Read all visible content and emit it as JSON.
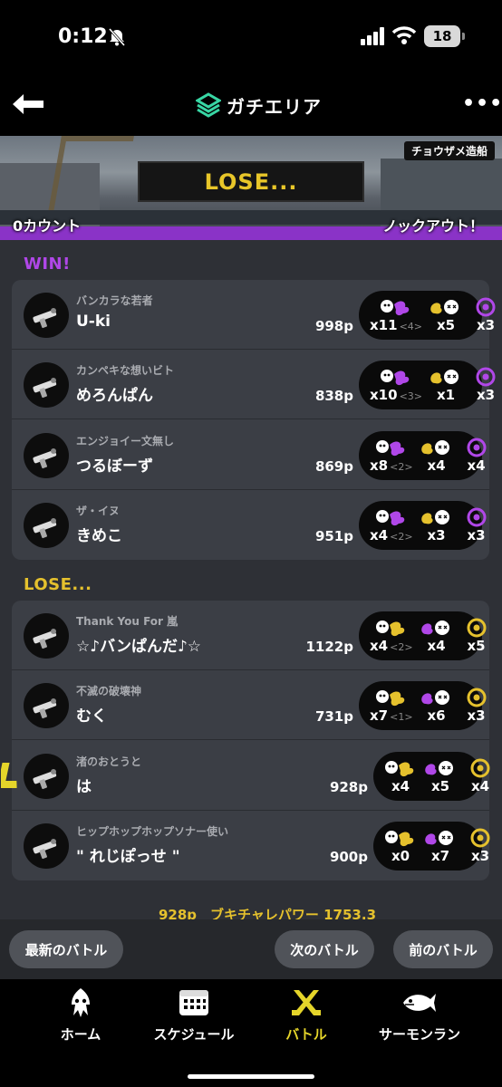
{
  "status": {
    "time": "0:12",
    "battery": "18"
  },
  "header": {
    "title": "ガチエリア"
  },
  "banner": {
    "result": "LOSE...",
    "stage": "チョウザメ造船",
    "our_count": "0カウント",
    "their_count": "ノックアウト！"
  },
  "win_section": {
    "label": "WIN!",
    "players": [
      {
        "title": "バンカラな若者",
        "name": "U-ki",
        "points": "998p",
        "stats": [
          {
            "icon": "kill-icon",
            "value": "x11",
            "sub": "<4>"
          },
          {
            "icon": "death-icon",
            "value": "x5"
          },
          {
            "icon": "special-icon",
            "value": "x3"
          }
        ]
      },
      {
        "title": "カンペキな想いビト",
        "name": "めろんぱん",
        "points": "838p",
        "stats": [
          {
            "icon": "kill-icon",
            "value": "x10",
            "sub": "<3>"
          },
          {
            "icon": "death-icon",
            "value": "x1"
          },
          {
            "icon": "special-icon",
            "value": "x3"
          }
        ]
      },
      {
        "title": "エンジョイー文無し",
        "name": "つるぼーず",
        "points": "869p",
        "stats": [
          {
            "icon": "kill-icon",
            "value": "x8",
            "sub": "<2>"
          },
          {
            "icon": "death-icon",
            "value": "x4"
          },
          {
            "icon": "special-icon",
            "value": "x4"
          }
        ]
      },
      {
        "title": "ザ・イヌ",
        "name": "きめこ",
        "points": "951p",
        "stats": [
          {
            "icon": "kill-icon",
            "value": "x4",
            "sub": "<2>"
          },
          {
            "icon": "death-icon",
            "value": "x3"
          },
          {
            "icon": "special-icon",
            "value": "x3"
          }
        ]
      }
    ]
  },
  "lose_section": {
    "label": "LOSE...",
    "players": [
      {
        "title": "Thank You For 嵐",
        "name": "☆♪バンぱんだ♪☆",
        "points": "1122p",
        "stats": [
          {
            "icon": "kill-icon",
            "value": "x4",
            "sub": "<2>"
          },
          {
            "icon": "death-icon",
            "value": "x4"
          },
          {
            "icon": "special-icon",
            "value": "x5"
          }
        ]
      },
      {
        "title": "不滅の破壊神",
        "name": "むく",
        "points": "731p",
        "stats": [
          {
            "icon": "kill-icon",
            "value": "x7",
            "sub": "<1>"
          },
          {
            "icon": "death-icon",
            "value": "x6"
          },
          {
            "icon": "special-icon",
            "value": "x3"
          }
        ]
      },
      {
        "title": "渚のおとうと",
        "name": "は",
        "points": "928p",
        "stats": [
          {
            "icon": "kill-icon",
            "value": "x4"
          },
          {
            "icon": "death-icon",
            "value": "x5"
          },
          {
            "icon": "special-icon",
            "value": "x4"
          }
        ]
      },
      {
        "title": "ヒップホップホップソナー使い",
        "name": "\" れじぽっせ \"",
        "points": "900p",
        "stats": [
          {
            "icon": "kill-icon",
            "value": "x0"
          },
          {
            "icon": "death-icon",
            "value": "x7"
          },
          {
            "icon": "special-icon",
            "value": "x3"
          }
        ]
      }
    ]
  },
  "power_line": "928p　ブキチャレパワー 1753.3",
  "nav": {
    "latest": "最新のバトル",
    "next": "次のバトル",
    "prev": "前のバトル"
  },
  "tabs": [
    {
      "label": "ホーム",
      "icon": "squid-home-icon"
    },
    {
      "label": "スケジュール",
      "icon": "calendar-icon"
    },
    {
      "label": "バトル",
      "icon": "battle-icon",
      "active": true
    },
    {
      "label": "サーモンラン",
      "icon": "salmon-icon"
    }
  ],
  "colors": {
    "win": "#b047e8",
    "lose": "#e5c12d",
    "accent_tab": "#e5d52a"
  }
}
